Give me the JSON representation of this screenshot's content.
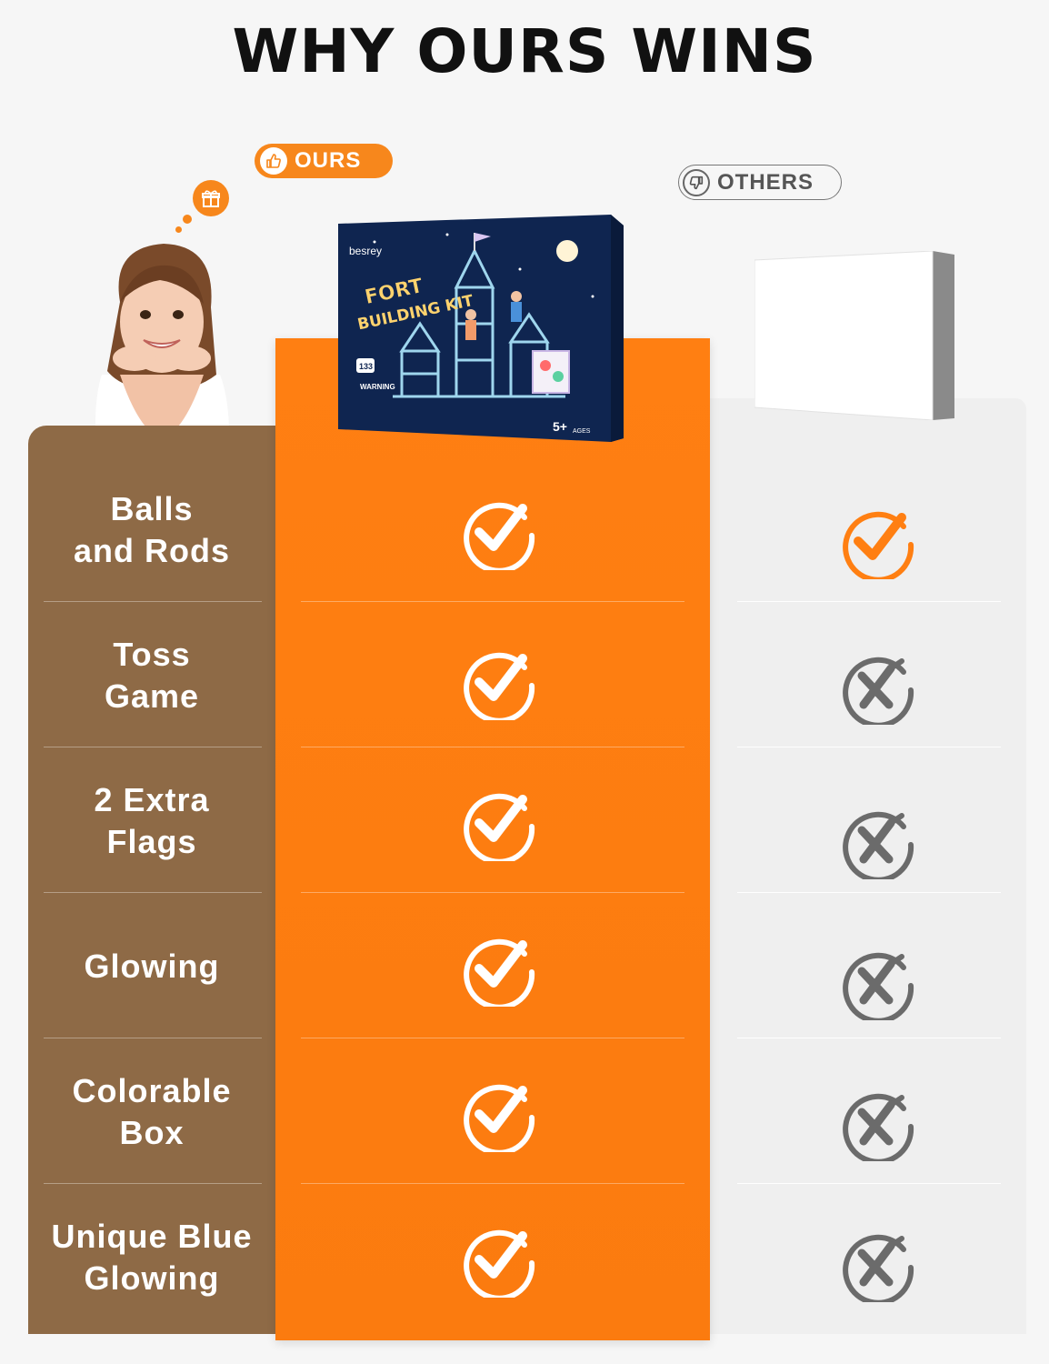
{
  "title": "WHY OURS WINS",
  "badges": {
    "ours": "OURS",
    "others": "OTHERS"
  },
  "product": {
    "brand": "besrey",
    "name_line1": "FORT",
    "name_line2": "BUILDING KIT",
    "pieces": "133",
    "age": "5+",
    "age_unit": "AGES",
    "warning": "WARNING"
  },
  "rows": [
    {
      "label": "Balls\nand Rods",
      "ours": "check",
      "others": "check"
    },
    {
      "label": "Toss\nGame",
      "ours": "check",
      "others": "cross"
    },
    {
      "label": "2 Extra\nFlags",
      "ours": "check",
      "others": "cross"
    },
    {
      "label": "Glowing",
      "ours": "check",
      "others": "cross"
    },
    {
      "label": "Colorable\nBox",
      "ours": "check",
      "others": "cross"
    },
    {
      "label": "Unique Blue\nGlowing",
      "ours": "check",
      "others": "cross"
    }
  ],
  "colors": {
    "accent": "#ff7f12",
    "labels_bg": "#8e6a46",
    "others_bg": "#efefef",
    "cross": "#6b6b6b"
  },
  "icons": {
    "ours_badge": "thumbs-up-icon",
    "others_badge": "thumbs-down-icon",
    "gift": "gift-icon"
  }
}
